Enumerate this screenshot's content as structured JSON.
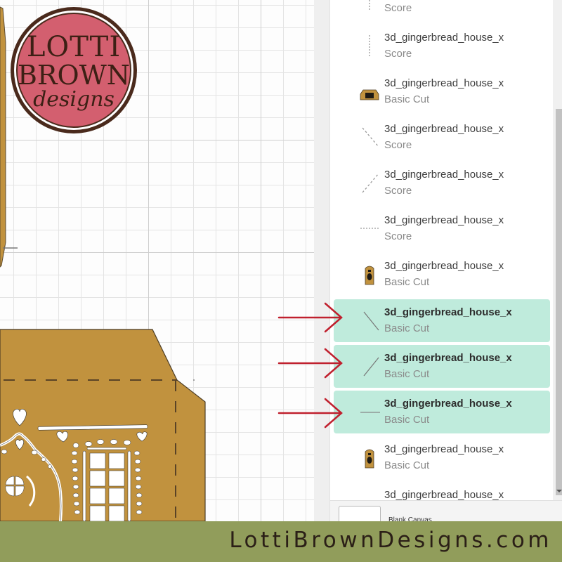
{
  "brand": {
    "logo": {
      "line1": "LOTTI",
      "line2": "BROWN",
      "line3": "designs"
    },
    "footer_url": "LottiBrownDesigns.com",
    "colors": {
      "logo_pink": "#d35f6f",
      "logo_brown": "#4a2a1c",
      "footer_green": "#919d5b",
      "gingerbread": "#c1923e",
      "selection": "#bfebdc",
      "arrow_red": "#c0202e"
    }
  },
  "layers_panel": {
    "items": [
      {
        "name": "",
        "operation": "Score",
        "thumb": "vertical-score-icon",
        "selected": false
      },
      {
        "name": "3d_gingerbread_house_x",
        "operation": "Score",
        "thumb": "vertical-score-icon",
        "selected": false
      },
      {
        "name": "3d_gingerbread_house_x",
        "operation": "Basic Cut",
        "thumb": "house-front-thumbnail",
        "selected": false
      },
      {
        "name": "3d_gingerbread_house_x",
        "operation": "Score",
        "thumb": "diagonal-down-score-icon",
        "selected": false
      },
      {
        "name": "3d_gingerbread_house_x",
        "operation": "Score",
        "thumb": "diagonal-up-score-icon",
        "selected": false
      },
      {
        "name": "3d_gingerbread_house_x",
        "operation": "Score",
        "thumb": "horizontal-score-icon",
        "selected": false
      },
      {
        "name": "3d_gingerbread_house_x",
        "operation": "Basic Cut",
        "thumb": "door-thumbnail",
        "selected": false
      },
      {
        "name": "3d_gingerbread_house_x",
        "operation": "Basic Cut",
        "thumb": "diagonal-down-line-icon",
        "selected": true
      },
      {
        "name": "3d_gingerbread_house_x",
        "operation": "Basic Cut",
        "thumb": "diagonal-up-line-icon",
        "selected": true
      },
      {
        "name": "3d_gingerbread_house_x",
        "operation": "Basic Cut",
        "thumb": "horizontal-line-icon",
        "selected": true
      },
      {
        "name": "3d_gingerbread_house_x",
        "operation": "Basic Cut",
        "thumb": "door-thumbnail",
        "selected": false
      },
      {
        "name": "3d_gingerbread_house_x",
        "operation": "",
        "thumb": "",
        "selected": false
      }
    ],
    "canvas_label": "Blank Canvas"
  },
  "annotations": {
    "arrows": [
      {
        "points_to": "layer-8",
        "description": "red arrow"
      },
      {
        "points_to": "layer-9",
        "description": "red arrow"
      },
      {
        "points_to": "layer-10",
        "description": "red arrow"
      }
    ]
  }
}
